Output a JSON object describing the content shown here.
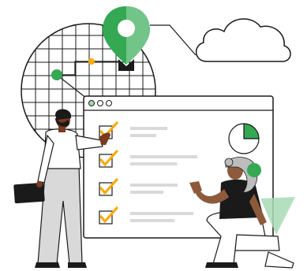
{
  "illustration": {
    "colors": {
      "ink": "#1a1a1a",
      "accent_green": "#34a853",
      "light_green": "#a8dab5",
      "check_yellow": "#f9ab00",
      "gray": "#d9d9d9",
      "dark_gray": "#9aa0a6",
      "skin_dark": "#7a3b1f",
      "skin_light": "#8d5a3b",
      "hair_gray": "#bdbdbd",
      "white": "#ffffff"
    },
    "icons": [
      "location-pin-icon",
      "cloud-icon",
      "globe-grid-icon",
      "checkmark-icon",
      "pie-chart-icon"
    ],
    "checklist": {
      "items": [
        {
          "checked": true
        },
        {
          "checked": true
        },
        {
          "checked": true
        },
        {
          "checked": true
        }
      ]
    },
    "pie_chart": {
      "slices": [
        {
          "label": "",
          "fraction": 0.25,
          "color": "#34a853"
        },
        {
          "label": "",
          "fraction": 0.75,
          "color": "#ffffff"
        }
      ]
    }
  }
}
